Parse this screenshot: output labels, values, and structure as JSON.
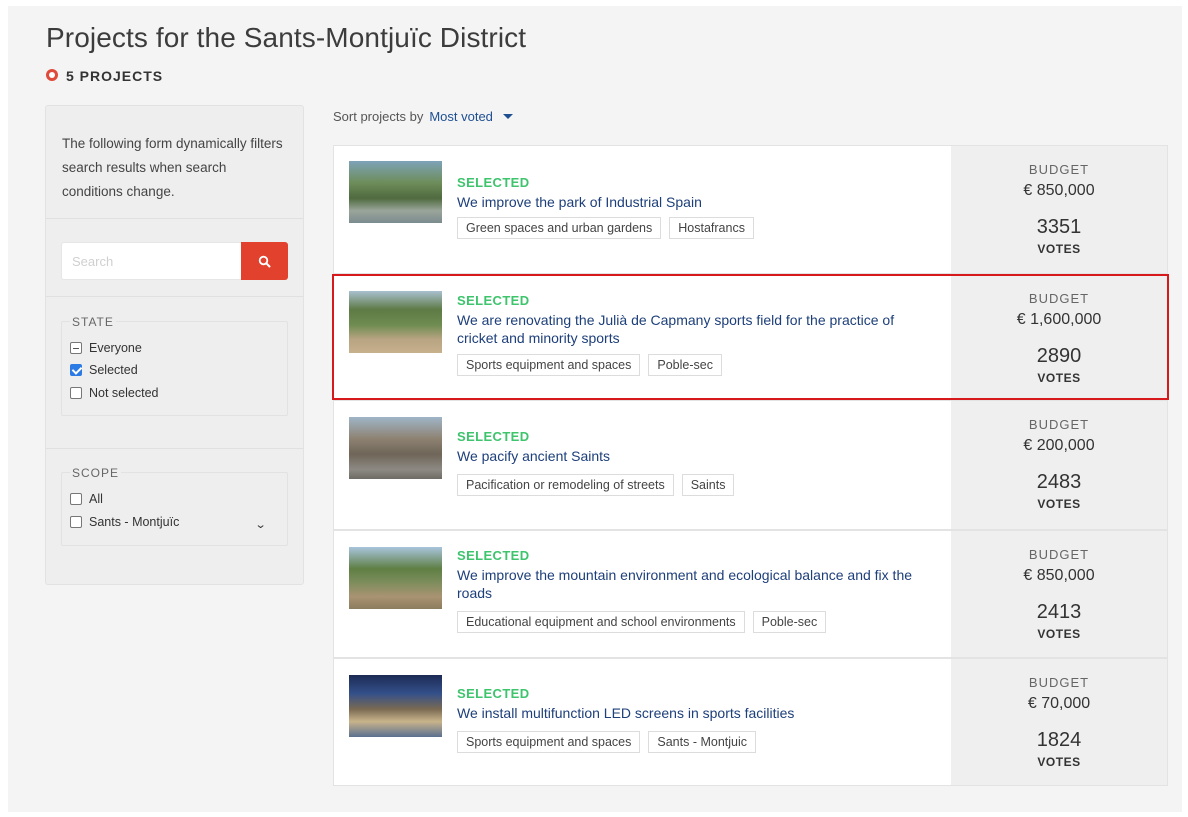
{
  "header": {
    "title": "Projects for the Sants-Montjuïc District",
    "count_label": "5 PROJECTS"
  },
  "sidebar": {
    "intro": "The following form dynamically filters search results when search conditions change.",
    "search_placeholder": "Search",
    "state": {
      "legend": "STATE",
      "options": [
        {
          "label": "Everyone",
          "state": "indeterminate"
        },
        {
          "label": "Selected",
          "state": "checked"
        },
        {
          "label": "Not selected",
          "state": "unchecked"
        }
      ]
    },
    "scope": {
      "legend": "SCOPE",
      "options": [
        {
          "label": "All",
          "state": "unchecked"
        },
        {
          "label": "Sants - Montjuïc",
          "state": "unchecked"
        }
      ]
    }
  },
  "sort": {
    "label": "Sort projects by",
    "value": "Most voted"
  },
  "projects": [
    {
      "status": "SELECTED",
      "title": "We improve the park of Industrial Spain",
      "tags": [
        "Green spaces and urban gardens",
        "Hostafrancs"
      ],
      "budget_label": "BUDGET",
      "budget": "€ 850,000",
      "votes": "3351",
      "votes_label": "VOTES"
    },
    {
      "status": "SELECTED",
      "title": "We are renovating the Julià de Capmany sports field for the practice of cricket and minority sports",
      "tags": [
        "Sports equipment and spaces",
        "Poble-sec"
      ],
      "budget_label": "BUDGET",
      "budget": "€ 1,600,000",
      "votes": "2890",
      "votes_label": "VOTES"
    },
    {
      "status": "SELECTED",
      "title": "We pacify ancient Saints",
      "tags": [
        "Pacification or remodeling of streets",
        "Saints"
      ],
      "budget_label": "BUDGET",
      "budget": "€ 200,000",
      "votes": "2483",
      "votes_label": "VOTES"
    },
    {
      "status": "SELECTED",
      "title": "We improve the mountain environment and ecological balance and fix the roads",
      "tags": [
        "Educational equipment and school environments",
        "Poble-sec"
      ],
      "budget_label": "BUDGET",
      "budget": "€ 850,000",
      "votes": "2413",
      "votes_label": "VOTES"
    },
    {
      "status": "SELECTED",
      "title": "We install multifunction LED screens in sports facilities",
      "tags": [
        "Sports equipment and spaces",
        "Sants - Montjuic"
      ],
      "budget_label": "BUDGET",
      "budget": "€ 70,000",
      "votes": "1824",
      "votes_label": "VOTES"
    }
  ],
  "colors": {
    "accent_red": "#e2412d",
    "selected_green": "#3ec46d",
    "link_blue": "#1d3f7a",
    "highlight_red": "#d7191c"
  }
}
